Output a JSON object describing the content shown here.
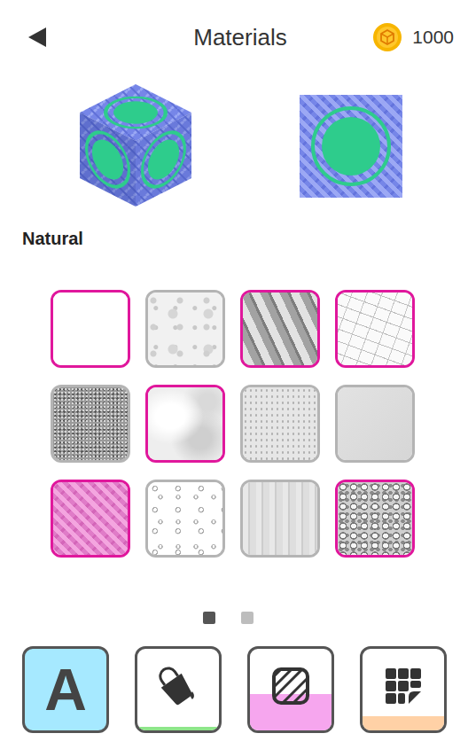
{
  "header": {
    "title": "Materials",
    "coins": "1000"
  },
  "section": {
    "title": "Natural"
  },
  "materials": [
    {
      "kind": "blank",
      "owned": true,
      "selected": false
    },
    {
      "kind": "grunge",
      "owned": false,
      "selected": false
    },
    {
      "kind": "shards",
      "owned": true,
      "selected": false
    },
    {
      "kind": "cracks",
      "owned": true,
      "selected": false
    },
    {
      "kind": "noise",
      "owned": false,
      "selected": false
    },
    {
      "kind": "clouds",
      "owned": true,
      "selected": false
    },
    {
      "kind": "speckle",
      "owned": false,
      "selected": false
    },
    {
      "kind": "smooth",
      "owned": false,
      "selected": false
    },
    {
      "kind": "weave",
      "owned": true,
      "selected": true
    },
    {
      "kind": "drops",
      "owned": false,
      "selected": false
    },
    {
      "kind": "wood",
      "owned": false,
      "selected": false
    },
    {
      "kind": "gravel",
      "owned": true,
      "selected": false
    }
  ],
  "pager": [
    {
      "selected": true
    },
    {
      "selected": false
    }
  ],
  "tools": [
    {
      "kind": "font",
      "label": "A",
      "selected": true,
      "level": 0,
      "color": "#a6e9ff"
    },
    {
      "kind": "paint",
      "label": "",
      "selected": false,
      "level": 0.04,
      "color": "#8ee68a"
    },
    {
      "kind": "pattern",
      "label": "",
      "selected": false,
      "level": 0.45,
      "color": "#f6a6ee"
    },
    {
      "kind": "tiles",
      "label": "",
      "selected": false,
      "level": 0.17,
      "color": "#ffd1a6"
    }
  ]
}
